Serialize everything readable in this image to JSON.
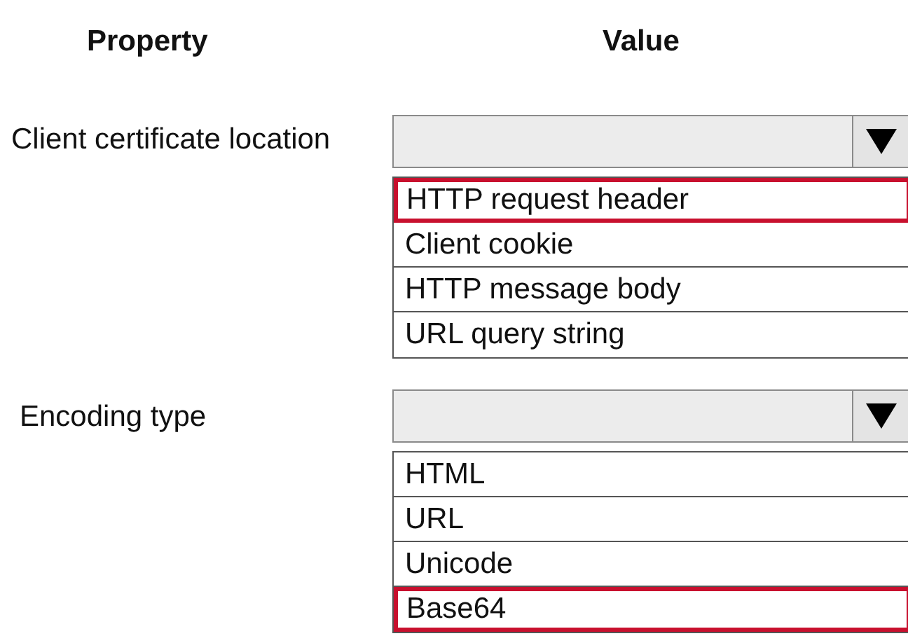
{
  "headers": [
    "Property",
    "Value"
  ],
  "rows": [
    {
      "property": "Client certificate location",
      "options": [
        {
          "label": "HTTP request header",
          "selected": true
        },
        {
          "label": "Client cookie",
          "selected": false
        },
        {
          "label": "HTTP message body",
          "selected": false
        },
        {
          "label": "URL query string",
          "selected": false
        }
      ]
    },
    {
      "property": "Encoding type",
      "options": [
        {
          "label": "HTML",
          "selected": false
        },
        {
          "label": "URL",
          "selected": false
        },
        {
          "label": "Unicode",
          "selected": false
        },
        {
          "label": "Base64",
          "selected": true
        }
      ]
    }
  ]
}
